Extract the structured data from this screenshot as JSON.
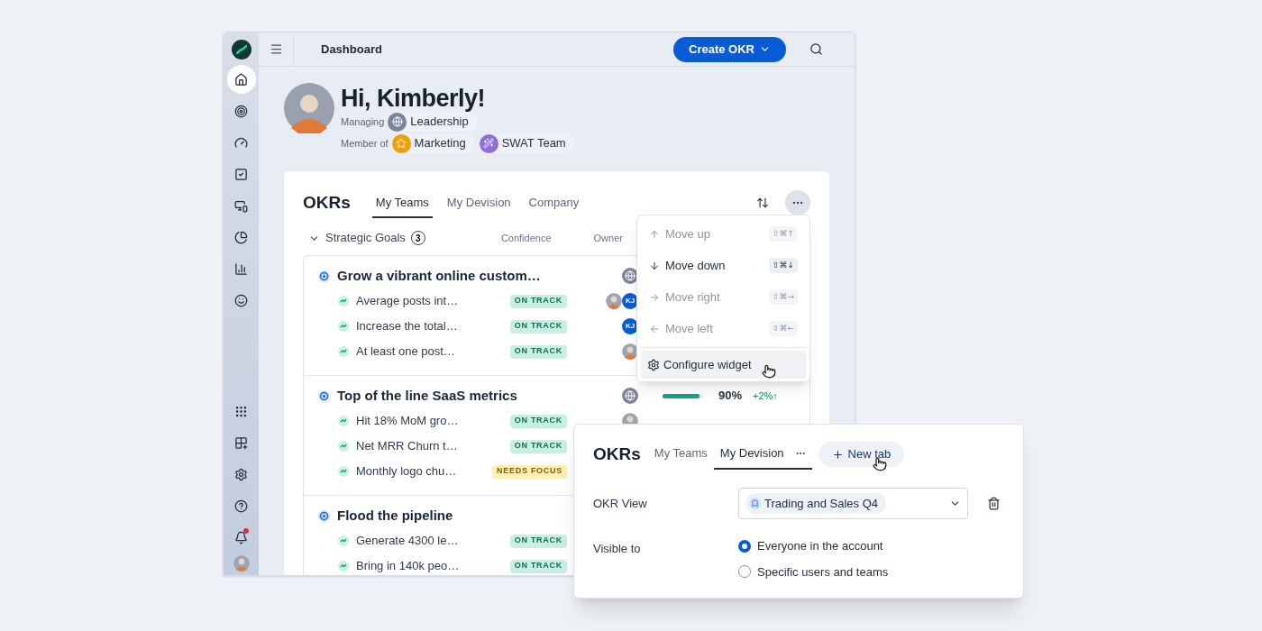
{
  "sidebar": {
    "top_items": [
      {
        "selected": true
      },
      {
        "selected": false
      },
      {
        "selected": false
      },
      {
        "selected": false
      },
      {
        "selected": false
      },
      {
        "selected": false
      },
      {
        "selected": false
      },
      {
        "selected": false
      }
    ],
    "bottom_items": [
      {
        "alert": false
      },
      {
        "alert": false
      },
      {
        "alert": false
      },
      {
        "alert": false
      },
      {
        "alert": true
      }
    ]
  },
  "topbar": {
    "title": "Dashboard",
    "create_button": "Create OKR"
  },
  "profile": {
    "greeting": "Hi, Kimberly!",
    "groups": [
      {
        "label": "Managing",
        "teams": [
          {
            "name": "Leadership",
            "kind": "globe",
            "color": "#7b8599"
          }
        ]
      },
      {
        "label": "Member of",
        "teams": [
          {
            "name": "Marketing",
            "kind": "star",
            "color": "#eea10b"
          },
          {
            "name": "SWAT Team",
            "kind": "wand",
            "color": "#8e6fdc"
          }
        ]
      }
    ]
  },
  "widget": {
    "title": "OKRs",
    "tabs": [
      {
        "label": "My Teams",
        "selected": true
      },
      {
        "label": "My Devision",
        "selected": false
      },
      {
        "label": "Company",
        "selected": false
      }
    ],
    "section": {
      "title": "Strategic Goals",
      "count": "3",
      "expanded": true,
      "columns": [
        "Confidence",
        "Owner"
      ],
      "goals": [
        {
          "title": "Grow a vibrant online custom…",
          "owners": [
            {
              "kind": "team"
            }
          ],
          "key_results": [
            {
              "title": "Average posts int…",
              "status": {
                "label": "ON TRACK",
                "kind": "on_track"
              },
              "owners": [
                {
                  "kind": "photo"
                },
                {
                  "kind": "initials",
                  "initials": "KJ"
                }
              ]
            },
            {
              "title": "Increase the total…",
              "status": {
                "label": "ON TRACK",
                "kind": "on_track"
              },
              "owners": [
                {
                  "kind": "initials",
                  "initials": "KJ"
                }
              ]
            },
            {
              "title": "At least one post…",
              "status": {
                "label": "ON TRACK",
                "kind": "on_track"
              },
              "owners": [
                {
                  "kind": "photo"
                }
              ]
            }
          ]
        },
        {
          "title": "Top of the line SaaS metrics",
          "owners": [
            {
              "kind": "team"
            }
          ],
          "confidence": {
            "level": 0.92,
            "value": "90%",
            "delta": "+2%↑"
          },
          "key_results": [
            {
              "title": "Hit 18% MoM gro…",
              "status": {
                "label": "ON TRACK",
                "kind": "on_track"
              },
              "owners": [
                {
                  "kind": "photo"
                }
              ]
            },
            {
              "title": "Net MRR Churn t…",
              "status": {
                "label": "ON TRACK",
                "kind": "on_track"
              }
            },
            {
              "title": "Monthly logo chu…",
              "status": {
                "label": "NEEDS FOCUS",
                "kind": "needs_focus"
              }
            }
          ]
        },
        {
          "title": "Flood the pipeline",
          "key_results": [
            {
              "title": "Generate 4300 le…",
              "status": {
                "label": "ON TRACK",
                "kind": "on_track"
              }
            },
            {
              "title": "Bring in 140k peo…",
              "status": {
                "label": "ON TRACK",
                "kind": "on_track"
              }
            }
          ]
        }
      ]
    }
  },
  "menu": {
    "items": [
      {
        "label": "Move up",
        "kind": "up",
        "shortcut": "⇧⌘↑",
        "disabled": true
      },
      {
        "label": "Move down",
        "kind": "down",
        "shortcut": "⇧⌘↓",
        "disabled": false
      },
      {
        "label": "Move right",
        "kind": "right",
        "shortcut": "⇧⌘→",
        "disabled": true
      },
      {
        "label": "Move left",
        "kind": "left",
        "shortcut": "⇧⌘←",
        "disabled": true
      }
    ],
    "action": {
      "label": "Configure widget",
      "highlighted": true
    }
  },
  "panel": {
    "title": "OKRs",
    "tabs": [
      {
        "label": "My Teams",
        "selected": false
      },
      {
        "label": "My Devision",
        "selected": true
      }
    ],
    "new_tab_button": "New tab",
    "view_label": "OKR View",
    "view_value": "Trading and Sales Q4",
    "visible_label": "Visible to",
    "options": [
      {
        "label": "Everyone in the account",
        "checked": true
      },
      {
        "label": "Specific users and teams",
        "checked": false
      }
    ]
  }
}
